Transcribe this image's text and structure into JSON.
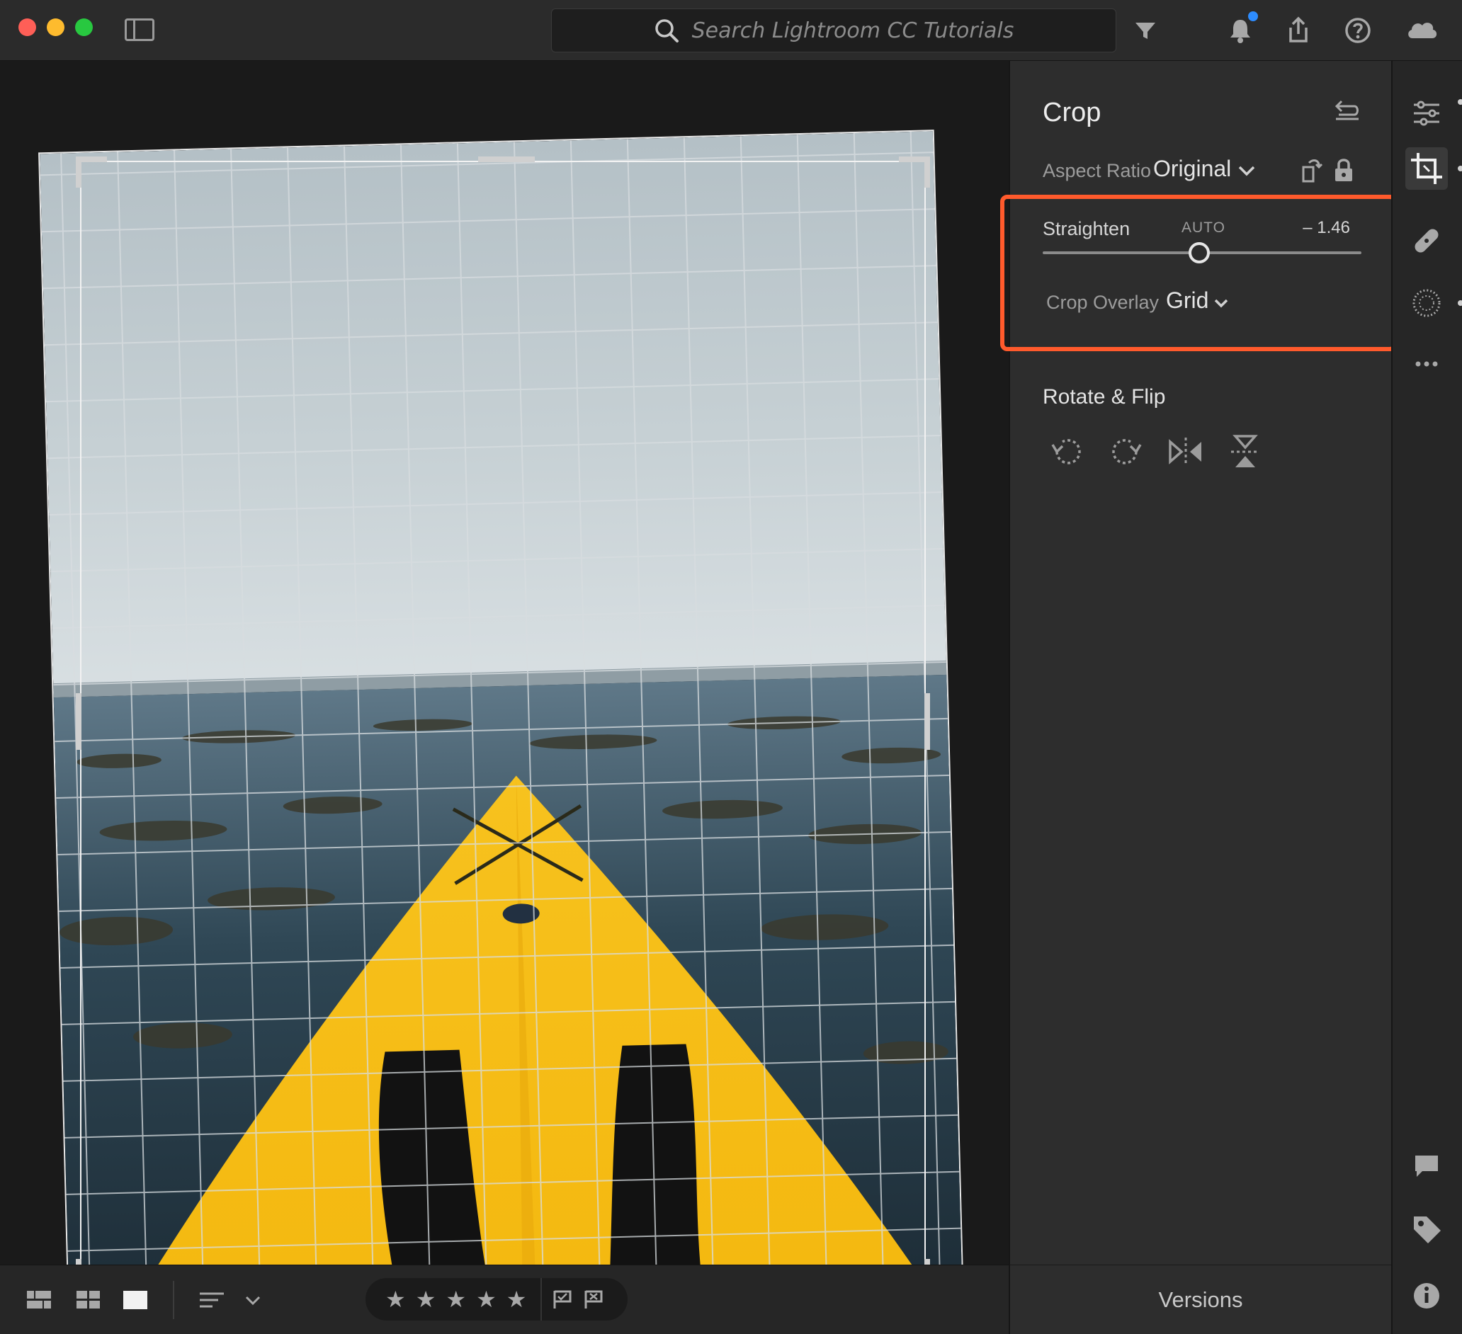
{
  "search": {
    "placeholder": "Search Lightroom CC Tutorials"
  },
  "panel": {
    "title": "Crop",
    "aspect_ratio": {
      "label": "Aspect Ratio",
      "value": "Original"
    },
    "straighten": {
      "label": "Straighten",
      "auto_label": "AUTO",
      "value": "– 1.46",
      "slider_fraction": 0.49
    },
    "crop_overlay": {
      "label": "Crop Overlay",
      "value": "Grid"
    },
    "rotate_flip": {
      "title": "Rotate & Flip"
    }
  },
  "bottombar": {
    "stars": [
      "★",
      "★",
      "★",
      "★",
      "★"
    ],
    "versions_label": "Versions"
  },
  "colors": {
    "highlight": "#ff5a2c",
    "notification": "#2d8cff",
    "kayak": "#f6c01c"
  },
  "icons": {
    "topbar": [
      "sidebar-icon",
      "search-icon",
      "filter-icon",
      "bell-icon",
      "share-icon",
      "help-icon",
      "cloud-icon"
    ],
    "tools": [
      "edit-sliders-icon",
      "crop-icon",
      "healing-icon",
      "masking-icon",
      "more-icon",
      "comment-icon",
      "tag-icon",
      "info-icon"
    ],
    "rotate_flip": [
      "rotate-left-icon",
      "rotate-right-icon",
      "flip-horizontal-icon",
      "flip-vertical-icon"
    ]
  }
}
